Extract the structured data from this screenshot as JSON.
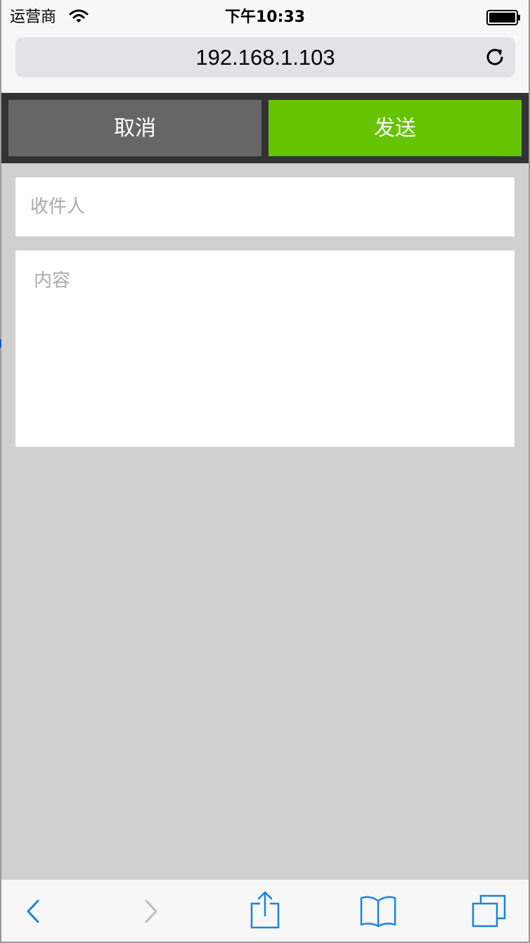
{
  "status_bar": {
    "carrier": "运营商",
    "time": "下午10:33"
  },
  "browser": {
    "url": "192.168.1.103"
  },
  "toolbar": {
    "cancel_label": "取消",
    "send_label": "发送",
    "cancel_color": "#666666",
    "send_color": "#66c300"
  },
  "form": {
    "recipient_placeholder": "收件人",
    "content_placeholder": "内容"
  },
  "bottom_bar": {
    "icons": [
      "back-icon",
      "forward-icon",
      "share-icon",
      "bookmarks-icon",
      "tabs-icon"
    ],
    "accent_color": "#1a82e0"
  }
}
